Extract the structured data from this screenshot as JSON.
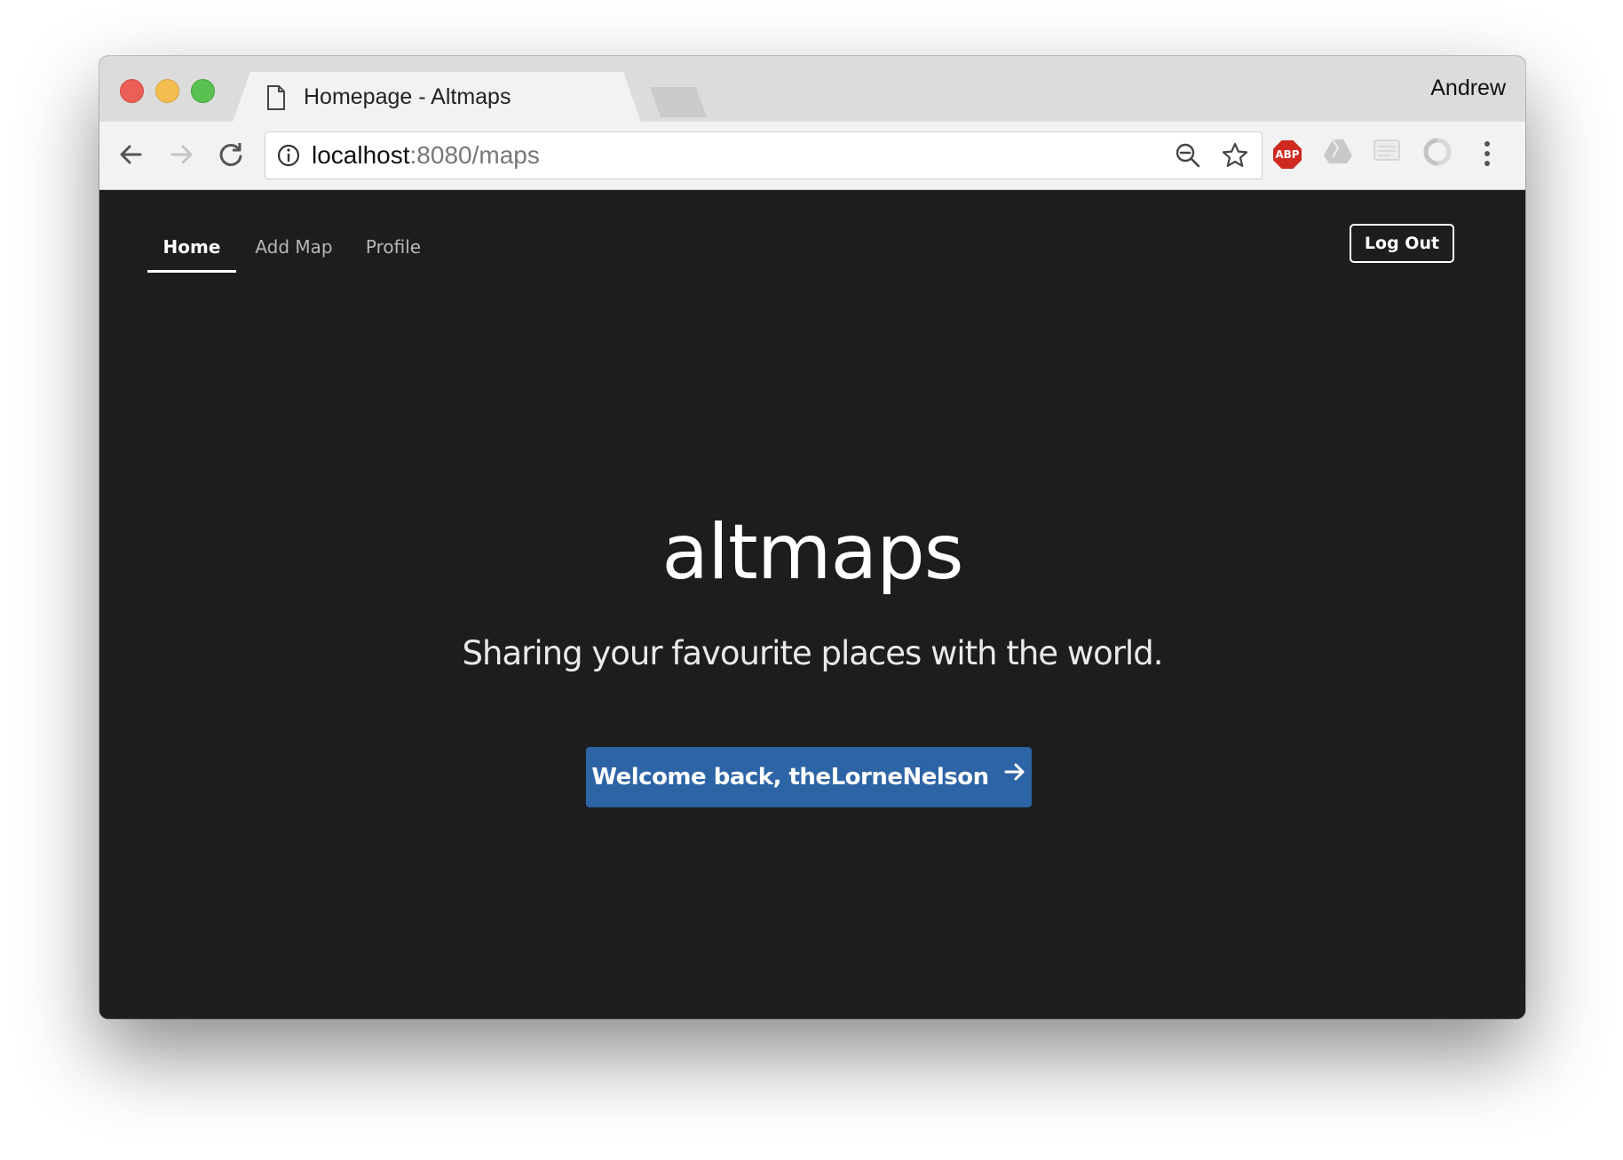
{
  "browser": {
    "tab": {
      "title": "Homepage - Altmaps",
      "icon": "page-icon"
    },
    "profile_name": "Andrew",
    "address": {
      "host": "localhost",
      "rest": ":8080/maps"
    },
    "extensions": [
      "abp-icon",
      "drive-icon",
      "note-icon",
      "loop-icon"
    ],
    "abp_label": "ABP"
  },
  "site": {
    "nav": [
      {
        "label": "Home",
        "active": true
      },
      {
        "label": "Add Map",
        "active": false
      },
      {
        "label": "Profile",
        "active": false
      }
    ],
    "logout_label": "Log Out",
    "hero": {
      "title": "altmaps",
      "subtitle": "Sharing your favourite places with the world.",
      "cta_label": "Welcome back, theLorneNelson"
    },
    "colors": {
      "background": "#1c1d1f",
      "accent": "#2d64a5"
    }
  }
}
